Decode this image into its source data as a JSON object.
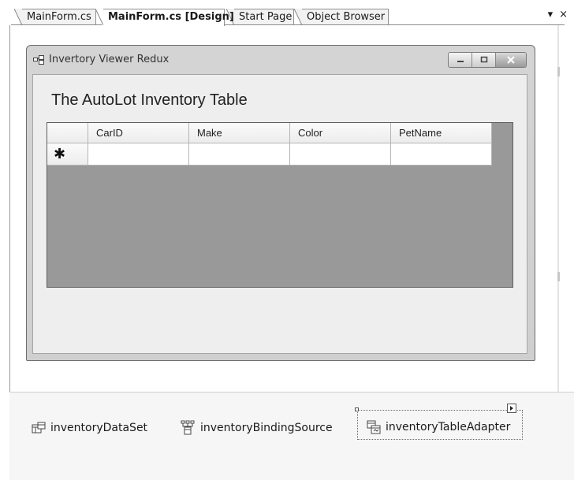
{
  "tabs": [
    {
      "label": "MainForm.cs",
      "active": false
    },
    {
      "label": "MainForm.cs [Design]",
      "active": true
    },
    {
      "label": "Start Page",
      "active": false
    },
    {
      "label": "Object Browser",
      "active": false
    }
  ],
  "tabstrip_buttons": {
    "dropdown_icon": "▾",
    "close_icon": "×"
  },
  "form": {
    "window_title": "Invertory Viewer Redux",
    "heading": "The AutoLot Inventory Table"
  },
  "grid": {
    "columns": [
      "CarID",
      "Make",
      "Color",
      "PetName"
    ],
    "new_row_marker": "✱"
  },
  "tray": {
    "components": [
      {
        "label": "inventoryDataSet",
        "icon": "dataset-icon"
      },
      {
        "label": "inventoryBindingSource",
        "icon": "binding-source-icon"
      },
      {
        "label": "inventoryTableAdapter",
        "icon": "table-adapter-icon",
        "selected": true
      }
    ]
  }
}
